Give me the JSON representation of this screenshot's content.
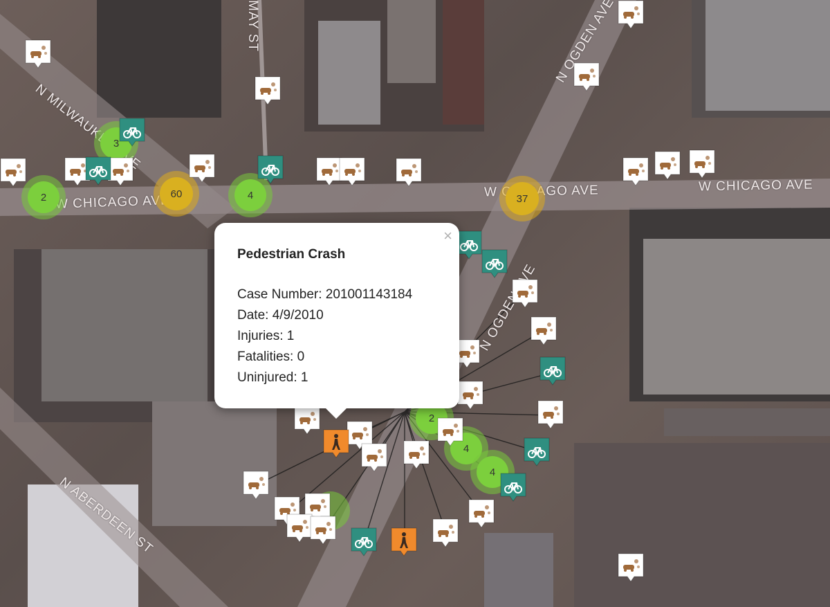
{
  "streets": {
    "milwaukee": "N MILWAUKEE AVE",
    "chicago_left": "W CHICAGO AVE",
    "chicago_right1": "W CHICAGO AVE",
    "chicago_right2": "W CHICAGO AVE",
    "ogden_top": "N OGDEN AVE",
    "ogden_mid": "N OGDEN AVE",
    "may": "MAY ST",
    "aberdeen": "N ABERDEEN ST"
  },
  "clusters": [
    {
      "count": "3",
      "color": "green"
    },
    {
      "count": "2",
      "color": "green"
    },
    {
      "count": "60",
      "color": "yellow"
    },
    {
      "count": "4",
      "color": "green"
    },
    {
      "count": "37",
      "color": "yellow"
    },
    {
      "count": "2",
      "color": "green"
    },
    {
      "count": "4",
      "color": "green"
    },
    {
      "count": "4",
      "color": "green"
    }
  ],
  "marker_types": {
    "car": {
      "icon": "car-crash-icon",
      "bg": "#ffffff",
      "fg": "#a06a3a"
    },
    "bike": {
      "icon": "bicycle-icon",
      "bg": "#2f8f80",
      "fg": "#ffffff"
    },
    "ped": {
      "icon": "pedestrian-icon",
      "bg": "#f08a2c",
      "fg": "#3a2a20"
    }
  },
  "popup": {
    "title": "Pedestrian Crash",
    "case_number": "Case Number: 201001143184",
    "date": "Date: 4/9/2010",
    "injuries": "Injuries: 1",
    "fatalities": "Fatalities: 0",
    "uninjured": "Uninjured: 1",
    "close": "×"
  }
}
